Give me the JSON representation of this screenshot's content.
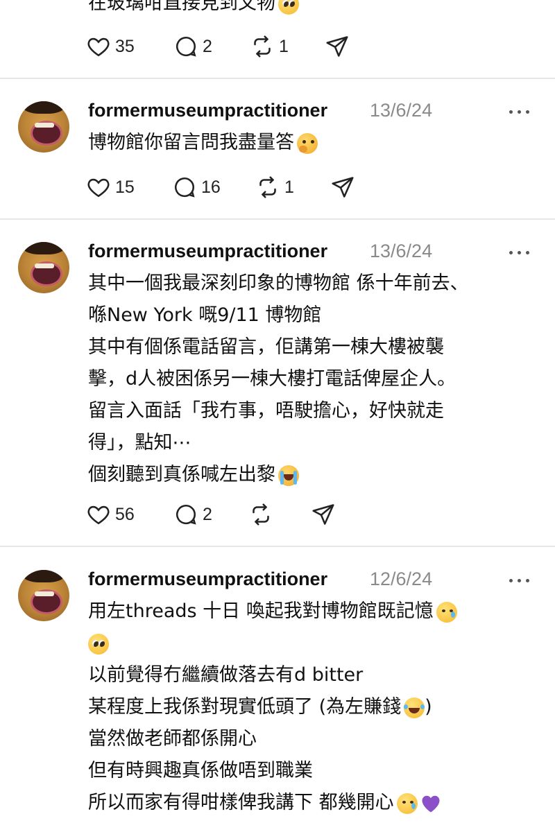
{
  "top_post": {
    "clipped_text": "在玻璃咁直接見到文物",
    "actions": {
      "likes": "35",
      "replies": "2",
      "reposts": "1"
    }
  },
  "posts": [
    {
      "username": "formermuseumpractitioner",
      "date": "13/6/24",
      "lines": [
        "博物館你留言問我盡量答"
      ],
      "actions": {
        "likes": "15",
        "replies": "16",
        "reposts": "1"
      }
    },
    {
      "username": "formermuseumpractitioner",
      "date": "13/6/24",
      "lines": [
        "其中一個我最深刻印象的博物館 係十年前去、",
        "喺New York 嘅9/11 博物館",
        "其中有個係電話留言，佢講第一棟大樓被襲",
        "擊，d人被困係另一棟大樓打電話俾屋企人。",
        "留言入面話「我冇事，唔駛擔心，好快就走",
        "得」，點知⋯",
        "個刻聽到真係喊左出黎"
      ],
      "actions": {
        "likes": "56",
        "replies": "2",
        "reposts": ""
      }
    },
    {
      "username": "formermuseumpractitioner",
      "date": "12/6/24",
      "lines": [
        "用左threads 十日 喚起我對博物館既記憶",
        "",
        "以前覺得冇繼續做落去有d bitter",
        "某程度上我係對現實低頭了 (為左賺錢",
        "當然做老師都係開心",
        "但有時興趣真係做唔到職業",
        "所以而家有得咁樣俾我講下 都幾開心"
      ],
      "line_suffix": [
        "",
        "",
        "",
        ")",
        "",
        "",
        ""
      ]
    }
  ],
  "icons": {
    "like": "heart-icon",
    "reply": "comment-icon",
    "repost": "repost-icon",
    "share": "send-icon",
    "more": "more-dots-icon"
  }
}
